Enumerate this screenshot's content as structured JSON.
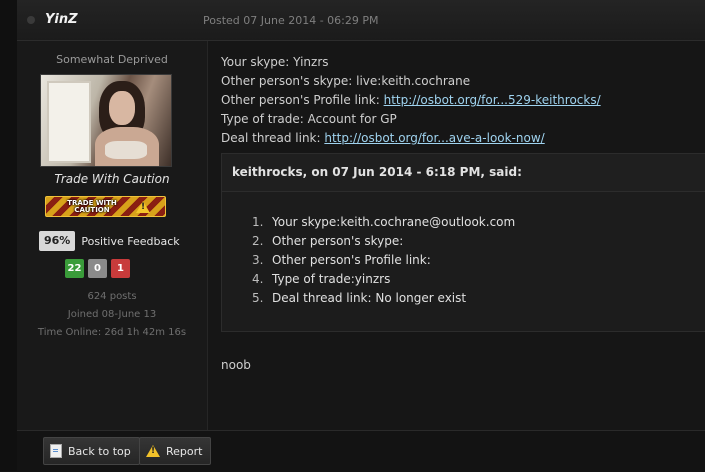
{
  "post": {
    "author": "YinZ",
    "date": "Posted 07 June 2014 - 06:29 PM"
  },
  "sidebar": {
    "member_title": "Somewhat Deprived",
    "caution_text": "Trade With Caution",
    "caution_badge": "TRADE WITH CAUTION",
    "feedback_percent": "96%",
    "feedback_label": "Positive Feedback",
    "feedback_counts": {
      "positive": "22",
      "neutral": "0",
      "negative": "1"
    },
    "posts": "624 posts",
    "joined": "Joined 08-June 13",
    "time_online": "Time Online: 26d 1h 42m 16s"
  },
  "content": {
    "lines": [
      {
        "label": "Your skype: ",
        "value": "Yinzrs"
      },
      {
        "label": "Other person's skype: ",
        "value": "live:keith.cochrane"
      },
      {
        "label": "Other person's Profile link: ",
        "link": "http://osbot.org/for...529-keithrocks/"
      },
      {
        "label": "Type of trade: ",
        "value": "Account for GP"
      },
      {
        "label": "Deal thread link: ",
        "link": "http://osbot.org/for...ave-a-look-now/"
      }
    ],
    "quote": {
      "header": "keithrocks, on 07 Jun 2014 - 6:18 PM, said:",
      "items": [
        {
          "n": "1.",
          "text": "Your skype:keith.cochrane@outlook.com"
        },
        {
          "n": "2.",
          "text": "Other person's skype:"
        },
        {
          "n": "3.",
          "text": "Other person's Profile link:"
        },
        {
          "n": "4.",
          "text": "Type of trade:yinzrs"
        },
        {
          "n": "5.",
          "text": "Deal thread link: No longer exist"
        }
      ]
    },
    "reply": "noob"
  },
  "footer": {
    "back_to_top": "Back to top",
    "report": "Report"
  },
  "icons": {
    "back_to_top": "document-icon",
    "report": "warning-icon",
    "caution": "warning-icon"
  }
}
